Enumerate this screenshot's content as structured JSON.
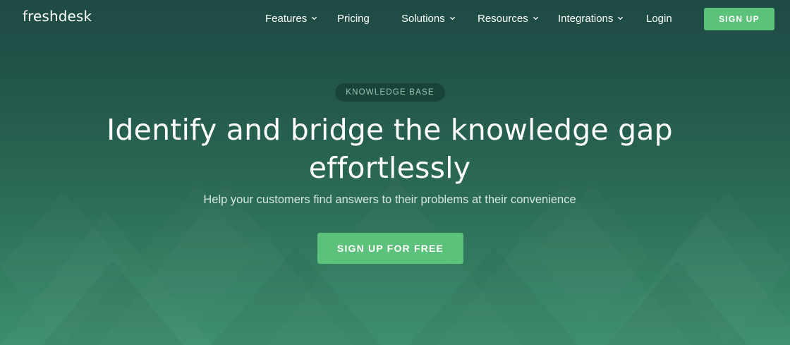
{
  "brand": {
    "logo_text": "freshdesk"
  },
  "nav": {
    "items": [
      {
        "label": "Features",
        "has_dropdown": true
      },
      {
        "label": "Pricing",
        "has_dropdown": false
      },
      {
        "label": "Solutions",
        "has_dropdown": true
      },
      {
        "label": "Resources",
        "has_dropdown": true
      },
      {
        "label": "Integrations",
        "has_dropdown": true
      },
      {
        "label": "Login",
        "has_dropdown": false
      }
    ],
    "signup_label": "SIGN UP"
  },
  "hero": {
    "badge": "KNOWLEDGE BASE",
    "headline_line1": "Identify and bridge the knowledge gap",
    "headline_line2": "effortlessly",
    "subtext": "Help your customers find answers to their problems at their convenience",
    "cta_label": "SIGN UP FOR FREE"
  },
  "colors": {
    "accent_green": "#5cc27b",
    "background_top": "#1e4a44",
    "background_bottom": "#3c8e6d"
  }
}
